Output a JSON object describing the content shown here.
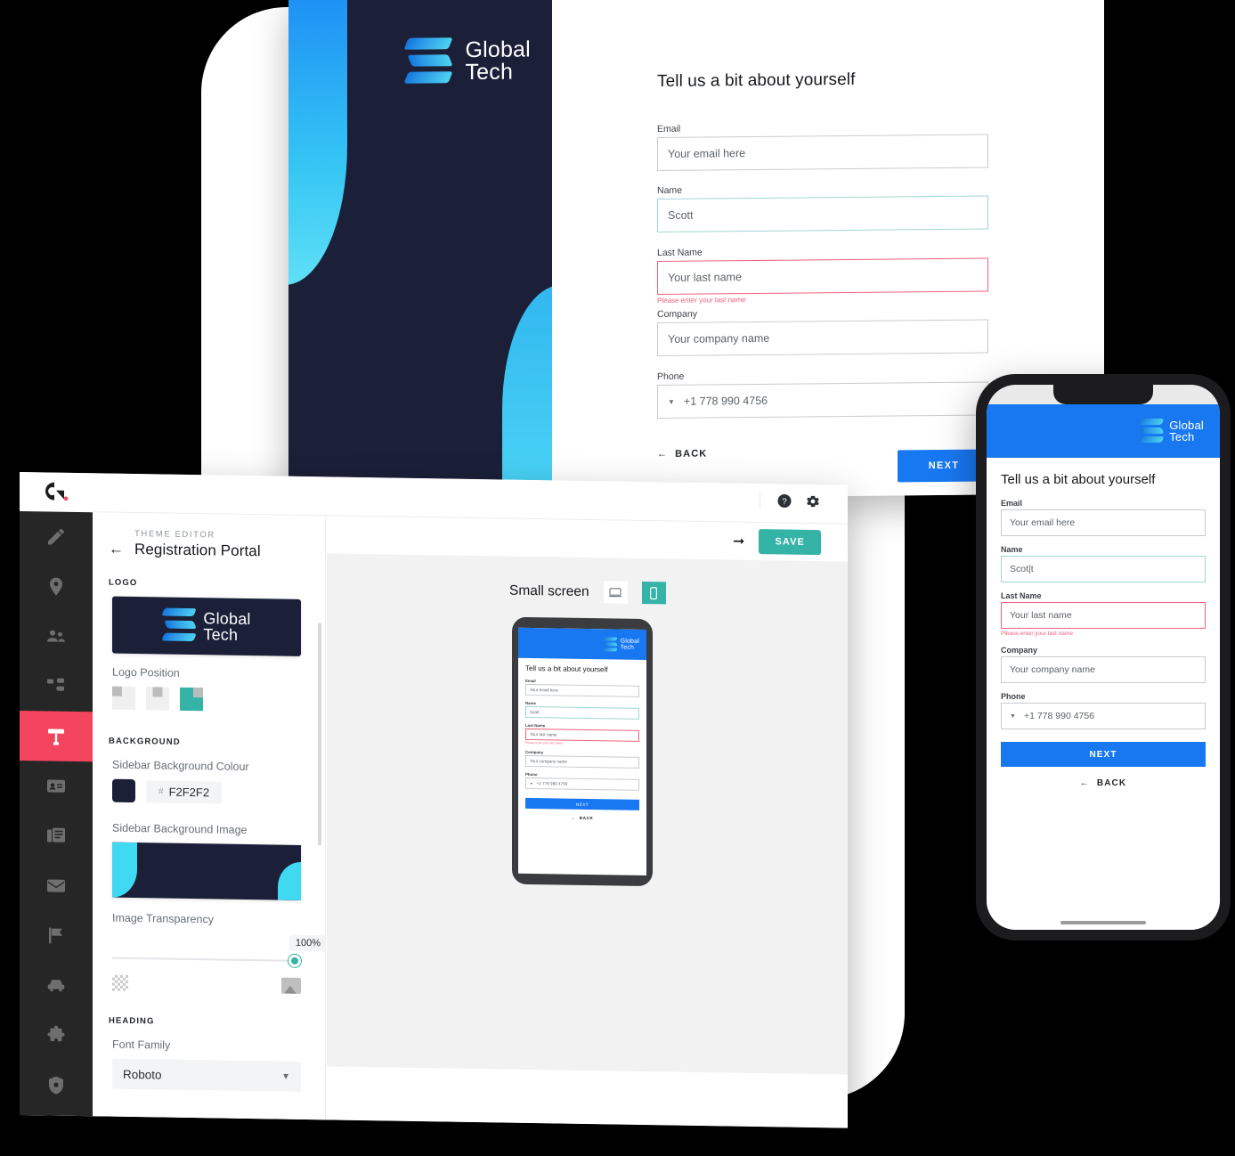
{
  "brand": {
    "logo_line1": "Global",
    "logo_line2": "Tech",
    "accent_blue": "#1878f2",
    "accent_teal": "#34b3a6",
    "accent_red": "#f4455f",
    "sidebar_navy": "#1b1f38",
    "error_pink": "#f4607e"
  },
  "registration": {
    "heading": "Tell us a bit about yourself",
    "fields": [
      {
        "label": "Email",
        "value": "Your email here",
        "state": "empty",
        "error": ""
      },
      {
        "label": "Name",
        "value": "Scott",
        "state": "valid",
        "error": ""
      },
      {
        "label": "Last Name",
        "value": "Your last name",
        "state": "error",
        "error": "Please enter your last name"
      },
      {
        "label": "Company",
        "value": "Your company name",
        "state": "empty",
        "error": ""
      },
      {
        "label": "Phone",
        "value": "+1 778 990 4756",
        "state": "empty",
        "error": ""
      }
    ],
    "back_label": "BACK",
    "next_label": "NEXT"
  },
  "phone_preview": {
    "heading": "Tell us a bit about yourself",
    "fields": [
      {
        "label": "Email",
        "value": "Your email here",
        "state": "empty",
        "error": ""
      },
      {
        "label": "Name",
        "value": "Scott",
        "state": "valid",
        "error": ""
      },
      {
        "label": "Last Name",
        "value": "Your last name",
        "state": "error",
        "error": "Please enter your last name"
      },
      {
        "label": "Company",
        "value": "Your company name",
        "state": "empty",
        "error": ""
      },
      {
        "label": "Phone",
        "value": "+1 778 990 4756",
        "state": "empty",
        "error": ""
      }
    ],
    "next_label": "NEXT",
    "back_label": "BACK"
  },
  "iphone": {
    "heading": "Tell us a bit about yourself",
    "fields": [
      {
        "label": "Email",
        "value": "Your email here",
        "state": "empty",
        "error": ""
      },
      {
        "label": "Name",
        "value": "Scot|t",
        "state": "valid",
        "error": ""
      },
      {
        "label": "Last Name",
        "value": "Your last name",
        "state": "error",
        "error": "Please enter your last name"
      },
      {
        "label": "Company",
        "value": "Your company name",
        "state": "empty",
        "error": ""
      },
      {
        "label": "Phone",
        "value": "+1 778 990 4756",
        "state": "empty",
        "error": ""
      }
    ],
    "next_label": "NEXT",
    "back_label": "BACK"
  },
  "app": {
    "topbar": {
      "help_icon": "help-circle-icon",
      "settings_icon": "gear-icon"
    },
    "rail": [
      {
        "name": "edit",
        "icon": "pencil-icon"
      },
      {
        "name": "locations",
        "icon": "map-pin-icon"
      },
      {
        "name": "people",
        "icon": "people-icon"
      },
      {
        "name": "org-chart",
        "icon": "sitemap-icon"
      },
      {
        "name": "theme",
        "icon": "paint-roller-icon",
        "active": true
      },
      {
        "name": "badges",
        "icon": "id-card-icon"
      },
      {
        "name": "documents",
        "icon": "article-icon"
      },
      {
        "name": "messages",
        "icon": "envelope-icon"
      },
      {
        "name": "flags",
        "icon": "flag-icon"
      },
      {
        "name": "vehicles",
        "icon": "car-icon"
      },
      {
        "name": "integrations",
        "icon": "puzzle-icon"
      },
      {
        "name": "security",
        "icon": "shield-icon"
      }
    ],
    "editor": {
      "eyebrow": "THEME EDITOR",
      "title": "Registration Portal",
      "back_icon": "arrow-left-icon",
      "save_label": "SAVE",
      "publish_icon": "arrow-right-icon",
      "sections": {
        "logo": {
          "title": "LOGO",
          "position_label": "Logo Position",
          "positions": [
            "left",
            "center",
            "right"
          ],
          "selected_position": "right"
        },
        "background": {
          "title": "BACKGROUND",
          "colour_label": "Sidebar Background Colour",
          "colour_hash": "#",
          "colour_value": "F2F2F2",
          "image_label": "Sidebar Background Image",
          "transparency_label": "Image Transparency",
          "transparency_value": "100%"
        },
        "heading": {
          "title": "HEADING",
          "font_family_label": "Font Family",
          "font_family_value": "Roboto"
        }
      }
    },
    "preview": {
      "screen_label": "Small screen",
      "devices": [
        "desktop-icon",
        "mobile-icon"
      ],
      "selected_device": "mobile-icon"
    }
  }
}
